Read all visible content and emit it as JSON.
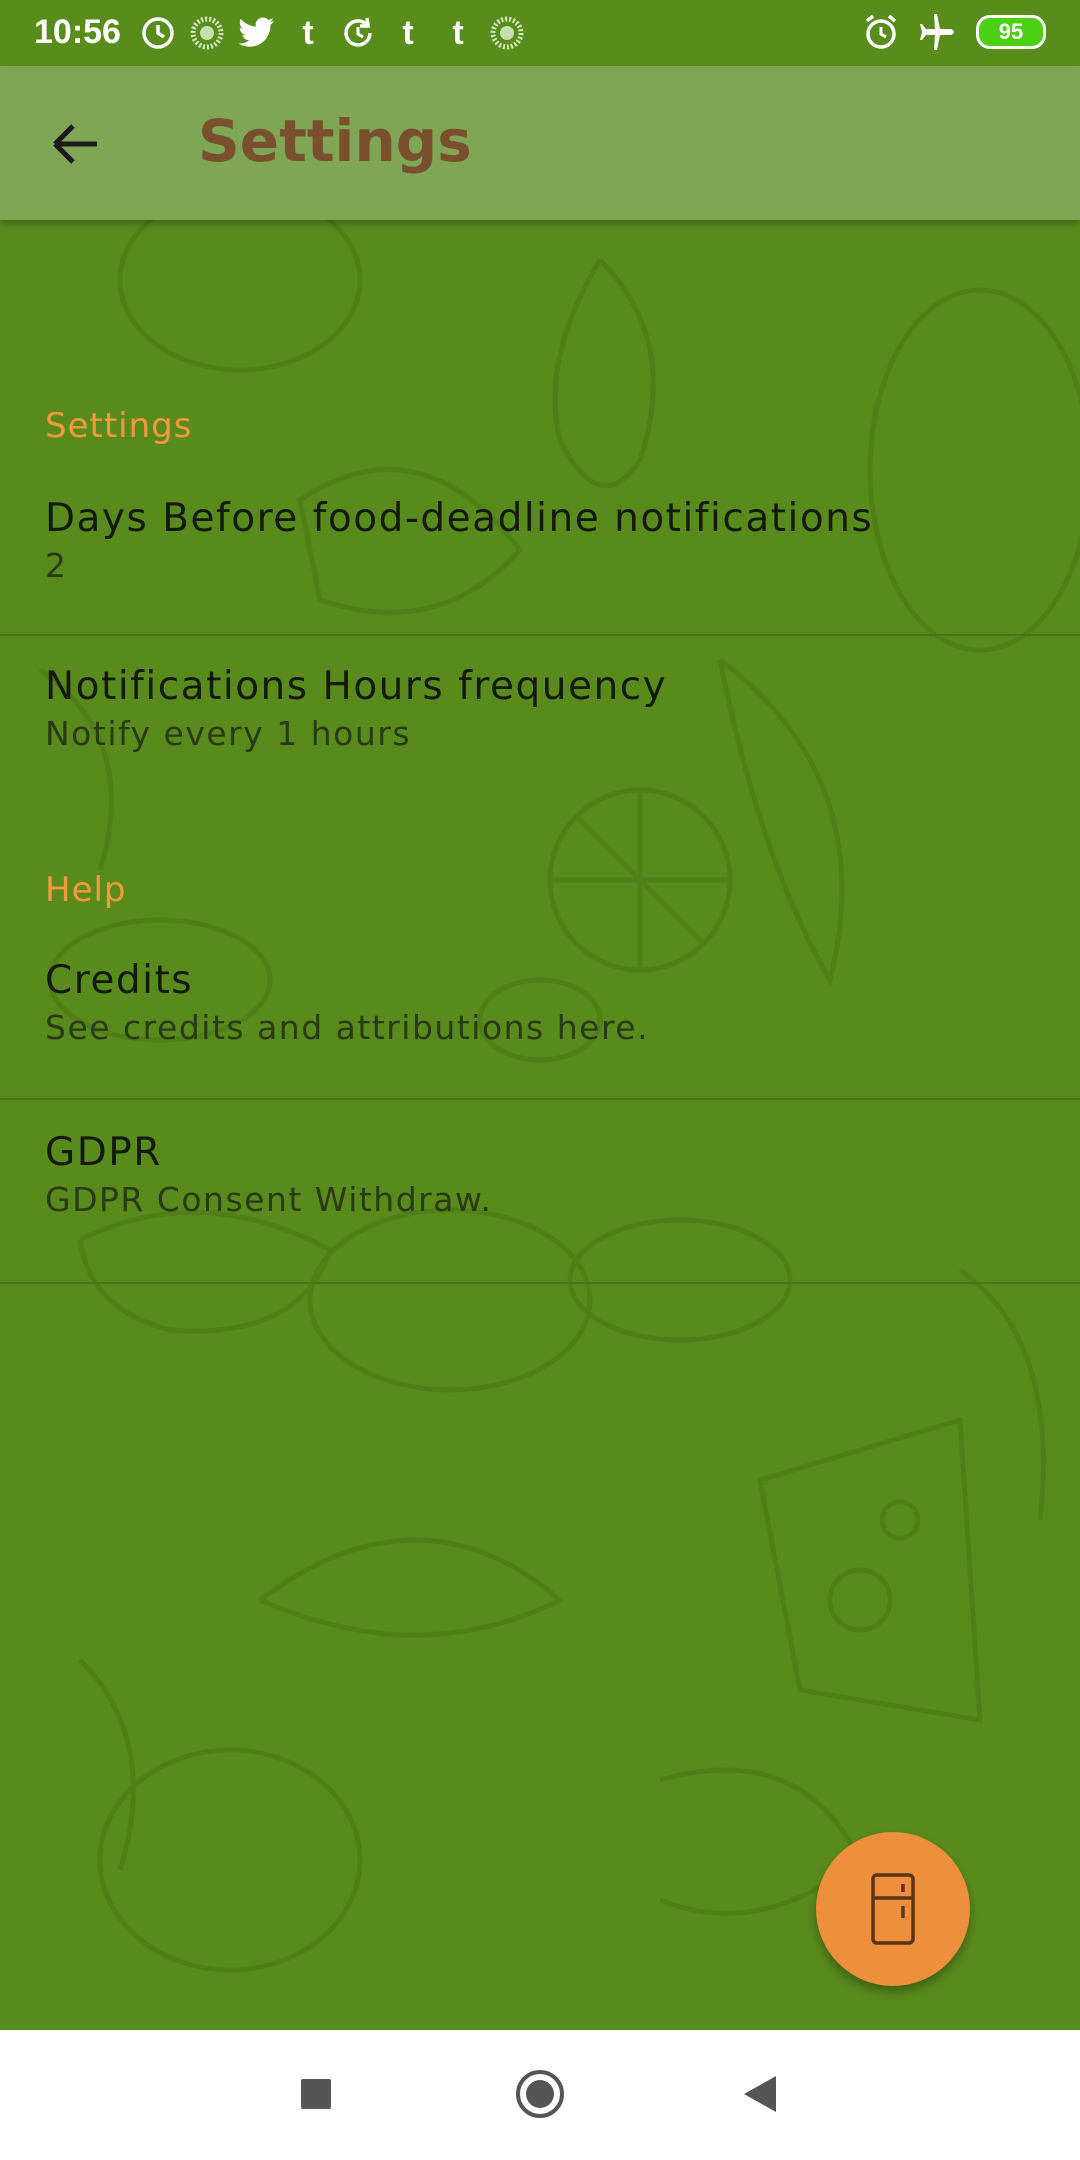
{
  "status_bar": {
    "time": "10:56",
    "battery": "95",
    "left_icons": [
      "alarm-clock-badge-icon",
      "dotted-circle-icon",
      "twitter-icon",
      "tumblr-icon",
      "refresh-icon",
      "tumblr-icon",
      "tumblr-icon",
      "dotted-circle-icon"
    ],
    "tumblr_glyph": "t",
    "right_icons": [
      "alarm-icon",
      "airplane-mode-icon",
      "battery-icon"
    ]
  },
  "app_bar": {
    "title": "Settings",
    "back_icon": "arrow-left-icon"
  },
  "sections": [
    {
      "header": "Settings",
      "items": [
        {
          "title": "Days Before food-deadline notifications",
          "summary": "2"
        },
        {
          "title": "Notifications Hours frequency",
          "summary": "Notify every 1 hours"
        }
      ]
    },
    {
      "header": "Help",
      "items": [
        {
          "title": "Credits",
          "summary": "See credits and attributions here."
        },
        {
          "title": "GDPR",
          "summary": "GDPR Consent Withdraw."
        }
      ]
    }
  ],
  "fab": {
    "icon": "fridge-icon"
  },
  "nav_bar": {
    "icons": [
      "recents-square-icon",
      "home-circle-icon",
      "back-triangle-icon"
    ]
  },
  "colors": {
    "background": "#598b1c",
    "app_bar": "#7ea654",
    "title": "#7a4f2e",
    "category": "#f29a3d",
    "fab": "#ee8f3c"
  }
}
